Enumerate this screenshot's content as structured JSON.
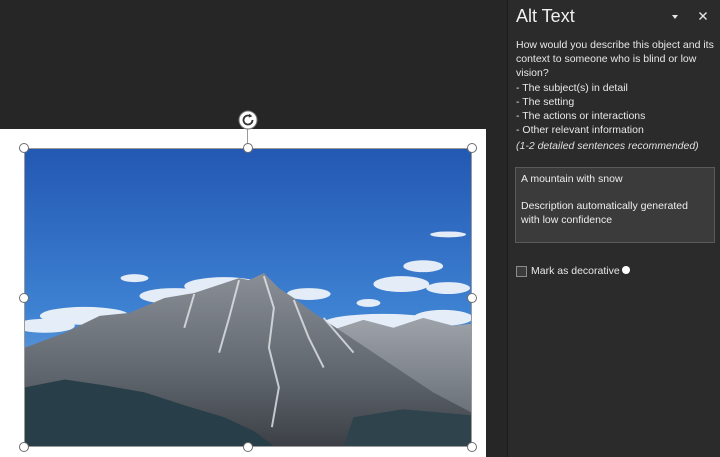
{
  "pane": {
    "title": "Alt Text",
    "question": "How would you describe this object and its context to someone who is blind or low vision?",
    "bullets": [
      "- The subject(s) in detail",
      "- The setting",
      "- The actions or interactions",
      "- Other relevant information"
    ],
    "recommendation": "(1-2 detailed sentences recommended)",
    "alt_text_value": "A mountain with snow\n\nDescription automatically generated with low confidence",
    "decorative_label": "Mark as decorative",
    "decorative_checked": false
  },
  "icons": {
    "dropdown": "chevron-down-icon",
    "close": "close-icon",
    "rotate": "rotate-icon",
    "info": "info-icon"
  },
  "colors": {
    "pane_background": "#2b2b2b",
    "workspace_background": "#262626",
    "text": "#e6e6e6",
    "sky": "#2f6fc4"
  }
}
